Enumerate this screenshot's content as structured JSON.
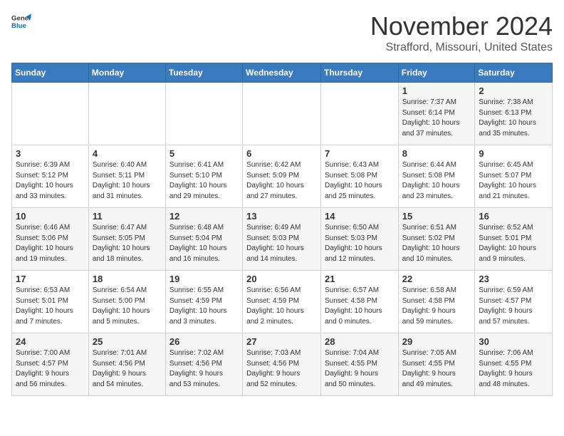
{
  "header": {
    "logo_line1": "General",
    "logo_line2": "Blue",
    "month": "November 2024",
    "location": "Strafford, Missouri, United States"
  },
  "days_of_week": [
    "Sunday",
    "Monday",
    "Tuesday",
    "Wednesday",
    "Thursday",
    "Friday",
    "Saturday"
  ],
  "weeks": [
    [
      {
        "day": "",
        "info": ""
      },
      {
        "day": "",
        "info": ""
      },
      {
        "day": "",
        "info": ""
      },
      {
        "day": "",
        "info": ""
      },
      {
        "day": "",
        "info": ""
      },
      {
        "day": "1",
        "info": "Sunrise: 7:37 AM\nSunset: 6:14 PM\nDaylight: 10 hours\nand 37 minutes."
      },
      {
        "day": "2",
        "info": "Sunrise: 7:38 AM\nSunset: 6:13 PM\nDaylight: 10 hours\nand 35 minutes."
      }
    ],
    [
      {
        "day": "3",
        "info": "Sunrise: 6:39 AM\nSunset: 5:12 PM\nDaylight: 10 hours\nand 33 minutes."
      },
      {
        "day": "4",
        "info": "Sunrise: 6:40 AM\nSunset: 5:11 PM\nDaylight: 10 hours\nand 31 minutes."
      },
      {
        "day": "5",
        "info": "Sunrise: 6:41 AM\nSunset: 5:10 PM\nDaylight: 10 hours\nand 29 minutes."
      },
      {
        "day": "6",
        "info": "Sunrise: 6:42 AM\nSunset: 5:09 PM\nDaylight: 10 hours\nand 27 minutes."
      },
      {
        "day": "7",
        "info": "Sunrise: 6:43 AM\nSunset: 5:08 PM\nDaylight: 10 hours\nand 25 minutes."
      },
      {
        "day": "8",
        "info": "Sunrise: 6:44 AM\nSunset: 5:08 PM\nDaylight: 10 hours\nand 23 minutes."
      },
      {
        "day": "9",
        "info": "Sunrise: 6:45 AM\nSunset: 5:07 PM\nDaylight: 10 hours\nand 21 minutes."
      }
    ],
    [
      {
        "day": "10",
        "info": "Sunrise: 6:46 AM\nSunset: 5:06 PM\nDaylight: 10 hours\nand 19 minutes."
      },
      {
        "day": "11",
        "info": "Sunrise: 6:47 AM\nSunset: 5:05 PM\nDaylight: 10 hours\nand 18 minutes."
      },
      {
        "day": "12",
        "info": "Sunrise: 6:48 AM\nSunset: 5:04 PM\nDaylight: 10 hours\nand 16 minutes."
      },
      {
        "day": "13",
        "info": "Sunrise: 6:49 AM\nSunset: 5:03 PM\nDaylight: 10 hours\nand 14 minutes."
      },
      {
        "day": "14",
        "info": "Sunrise: 6:50 AM\nSunset: 5:03 PM\nDaylight: 10 hours\nand 12 minutes."
      },
      {
        "day": "15",
        "info": "Sunrise: 6:51 AM\nSunset: 5:02 PM\nDaylight: 10 hours\nand 10 minutes."
      },
      {
        "day": "16",
        "info": "Sunrise: 6:52 AM\nSunset: 5:01 PM\nDaylight: 10 hours\nand 9 minutes."
      }
    ],
    [
      {
        "day": "17",
        "info": "Sunrise: 6:53 AM\nSunset: 5:01 PM\nDaylight: 10 hours\nand 7 minutes."
      },
      {
        "day": "18",
        "info": "Sunrise: 6:54 AM\nSunset: 5:00 PM\nDaylight: 10 hours\nand 5 minutes."
      },
      {
        "day": "19",
        "info": "Sunrise: 6:55 AM\nSunset: 4:59 PM\nDaylight: 10 hours\nand 3 minutes."
      },
      {
        "day": "20",
        "info": "Sunrise: 6:56 AM\nSunset: 4:59 PM\nDaylight: 10 hours\nand 2 minutes."
      },
      {
        "day": "21",
        "info": "Sunrise: 6:57 AM\nSunset: 4:58 PM\nDaylight: 10 hours\nand 0 minutes."
      },
      {
        "day": "22",
        "info": "Sunrise: 6:58 AM\nSunset: 4:58 PM\nDaylight: 9 hours\nand 59 minutes."
      },
      {
        "day": "23",
        "info": "Sunrise: 6:59 AM\nSunset: 4:57 PM\nDaylight: 9 hours\nand 57 minutes."
      }
    ],
    [
      {
        "day": "24",
        "info": "Sunrise: 7:00 AM\nSunset: 4:57 PM\nDaylight: 9 hours\nand 56 minutes."
      },
      {
        "day": "25",
        "info": "Sunrise: 7:01 AM\nSunset: 4:56 PM\nDaylight: 9 hours\nand 54 minutes."
      },
      {
        "day": "26",
        "info": "Sunrise: 7:02 AM\nSunset: 4:56 PM\nDaylight: 9 hours\nand 53 minutes."
      },
      {
        "day": "27",
        "info": "Sunrise: 7:03 AM\nSunset: 4:56 PM\nDaylight: 9 hours\nand 52 minutes."
      },
      {
        "day": "28",
        "info": "Sunrise: 7:04 AM\nSunset: 4:55 PM\nDaylight: 9 hours\nand 50 minutes."
      },
      {
        "day": "29",
        "info": "Sunrise: 7:05 AM\nSunset: 4:55 PM\nDaylight: 9 hours\nand 49 minutes."
      },
      {
        "day": "30",
        "info": "Sunrise: 7:06 AM\nSunset: 4:55 PM\nDaylight: 9 hours\nand 48 minutes."
      }
    ]
  ]
}
